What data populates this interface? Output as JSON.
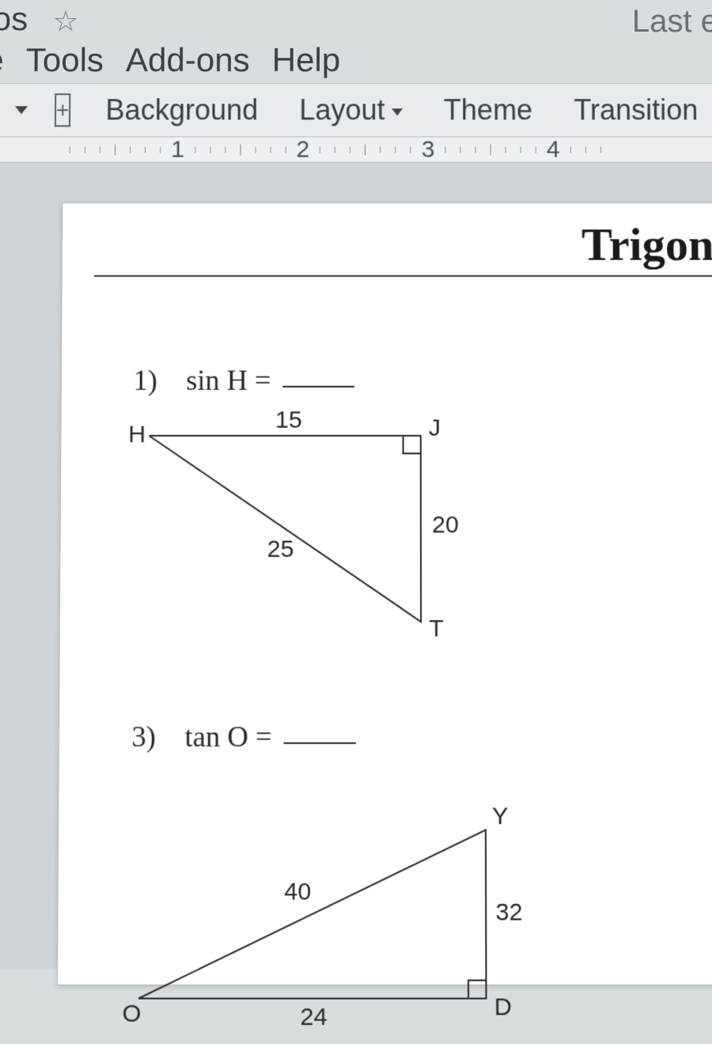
{
  "title_fragment": "tios",
  "menu": {
    "leading_fragment": "e",
    "items": [
      "Tools",
      "Add-ons",
      "Help"
    ]
  },
  "last_edit_fragment": "Last edit ",
  "toolbar": {
    "new_slide_plus": "+",
    "background": "Background",
    "layout": "Layout",
    "theme": "Theme",
    "transition": "Transition"
  },
  "ruler": {
    "marks": [
      "1",
      "2",
      "3",
      "4"
    ]
  },
  "slide": {
    "title_fragment": "Trigono",
    "problems": [
      {
        "num": "1)",
        "expr": "sin H =",
        "triangle": {
          "vertices": {
            "A": "H",
            "B": "J",
            "C": "T"
          },
          "sides": {
            "top": "15",
            "right": "20",
            "hyp": "25"
          }
        }
      },
      {
        "num": "3)",
        "expr": "tan O =",
        "triangle": {
          "vertices": {
            "A": "O",
            "B": "Y",
            "C": "D"
          },
          "sides": {
            "hyp": "40",
            "right": "32",
            "bottom": "24"
          }
        }
      }
    ]
  }
}
